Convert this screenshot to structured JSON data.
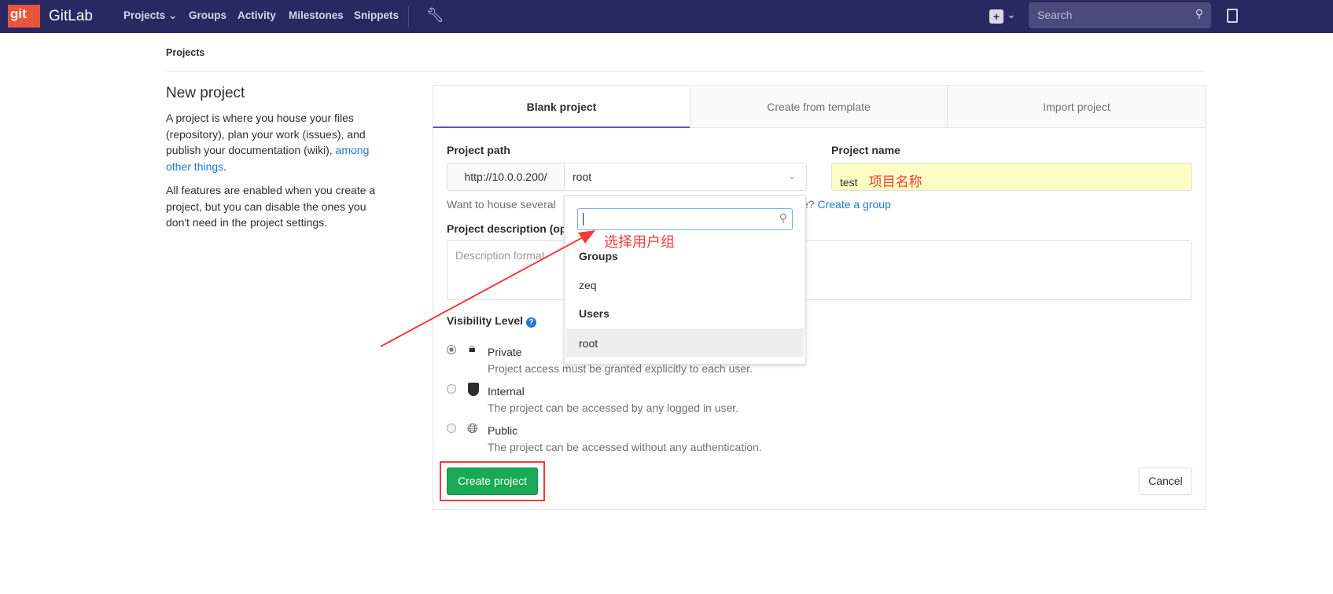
{
  "nav": {
    "logo": "git",
    "brand": "GitLab",
    "items": [
      "Projects",
      "Groups",
      "Activity",
      "Milestones",
      "Snippets"
    ],
    "search_placeholder": "Search"
  },
  "breadcrumb": "Projects",
  "intro": {
    "title": "New project",
    "p1_before": "A project is where you house your files (repository), plan your work (issues), and publish your documentation (wiki), ",
    "p1_link": "among other things",
    "p1_after": ".",
    "p2": "All features are enabled when you create a project, but you can disable the ones you don't need in the project settings."
  },
  "tabs": [
    "Blank project",
    "Create from template",
    "Import project"
  ],
  "form": {
    "path_label": "Project path",
    "path_prefix": "http://10.0.0.200/",
    "namespace": "root",
    "name_label": "Project name",
    "name_value": "test",
    "help_before": "Want to house several",
    "help_after": "e?",
    "help_link": "Create a group",
    "desc_label": "Project description (op",
    "desc_placeholder": "Description format",
    "visibility_label": "Visibility Level",
    "visibility": [
      {
        "label": "Private",
        "desc": "Project access must be granted explicitly to each user.",
        "checked": true
      },
      {
        "label": "Internal",
        "desc": "The project can be accessed by any logged in user.",
        "checked": false
      },
      {
        "label": "Public",
        "desc": "The project can be accessed without any authentication.",
        "checked": false
      }
    ],
    "create": "Create project",
    "cancel": "Cancel"
  },
  "dropdown": {
    "sections": [
      {
        "header": "Groups",
        "items": [
          "zeq"
        ]
      },
      {
        "header": "Users",
        "items": [
          "root"
        ]
      }
    ]
  },
  "annotations": {
    "name_note": "项目名称",
    "group_note": "选择用户组"
  },
  "colors": {
    "navbar": "#292961",
    "accent": "#6b4fbb",
    "create": "#1aaa55",
    "annotation": "#f23b3b"
  }
}
